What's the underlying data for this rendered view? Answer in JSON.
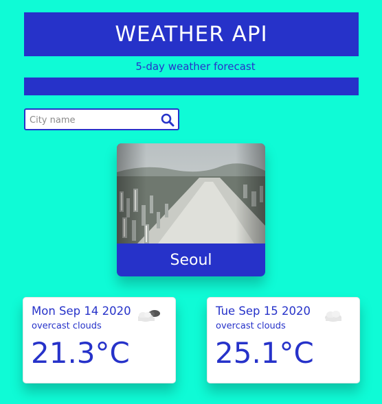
{
  "header": {
    "title": "WEATHER API",
    "subtitle": "5-day weather forecast"
  },
  "search": {
    "placeholder": "City name",
    "icon": "search-icon"
  },
  "city": {
    "name": "Seoul",
    "photo": "city-photo-river-skyline"
  },
  "forecast": [
    {
      "date": "Mon Sep 14 2020",
      "description": "overcast clouds",
      "temperature": "21.3°C",
      "icon": "overcast-clouds-icon"
    },
    {
      "date": "Tue Sep 15 2020",
      "description": "overcast clouds",
      "temperature": "25.1°C",
      "icon": "cloud-icon"
    }
  ],
  "colors": {
    "background": "#0ffbd6",
    "accent": "#2632c9",
    "card": "#ffffff"
  }
}
